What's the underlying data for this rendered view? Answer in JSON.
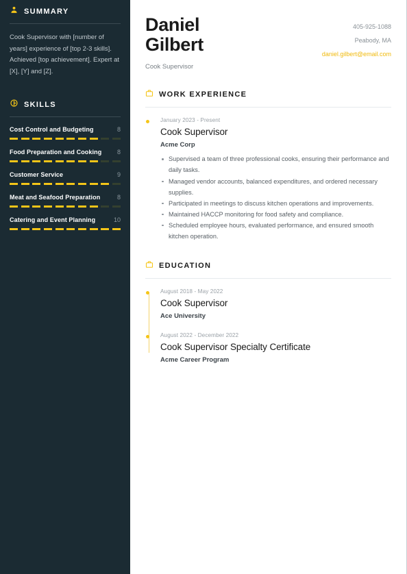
{
  "accent": "#f5c518",
  "sidebar_bg": "#1b2b33",
  "header": {
    "first_name": "Daniel",
    "last_name": "Gilbert",
    "role": "Cook Supervisor",
    "contact": {
      "phone": "405-925-1088",
      "location": "Peabody, MA",
      "email": "daniel.gilbert@email.com"
    }
  },
  "sidebar": {
    "summary": {
      "icon": "user-icon",
      "title": "SUMMARY",
      "text": "Cook Supervisor with [number of years] experience of [top 2-3 skills]. Achieved [top achievement]. Expert at [X], [Y] and [Z]."
    },
    "skills": {
      "icon": "medal-icon",
      "title": "SKILLS",
      "max": 10,
      "items": [
        {
          "name": "Cost Control and Budgeting",
          "score": 8
        },
        {
          "name": "Food Preparation and Cooking",
          "score": 8
        },
        {
          "name": "Customer Service",
          "score": 9
        },
        {
          "name": "Meat and Seafood Preparation",
          "score": 8
        },
        {
          "name": "Catering and Event Planning",
          "score": 10
        }
      ]
    }
  },
  "main": {
    "work": {
      "icon": "briefcase-icon",
      "title": "WORK EXPERIENCE",
      "entries": [
        {
          "date": "January 2023 - Present",
          "title": "Cook Supervisor",
          "org": "Acme Corp",
          "bullets": [
            "Supervised a team of three professional cooks, ensuring their performance and daily tasks.",
            "Managed vendor accounts, balanced expenditures, and ordered necessary supplies.",
            "Participated in meetings to discuss kitchen operations and improvements.",
            "Maintained HACCP monitoring for food safety and compliance.",
            "Scheduled employee hours, evaluated performance, and ensured smooth kitchen operation."
          ]
        }
      ]
    },
    "education": {
      "icon": "briefcase-icon",
      "title": "EDUCATION",
      "entries": [
        {
          "date": "August 2018 - May 2022",
          "title": "Cook Supervisor",
          "org": "Ace University",
          "bullets": []
        },
        {
          "date": "August 2022 - December 2022",
          "title": "Cook Supervisor Specialty Certificate",
          "org": "Acme Career Program",
          "bullets": []
        }
      ]
    }
  }
}
